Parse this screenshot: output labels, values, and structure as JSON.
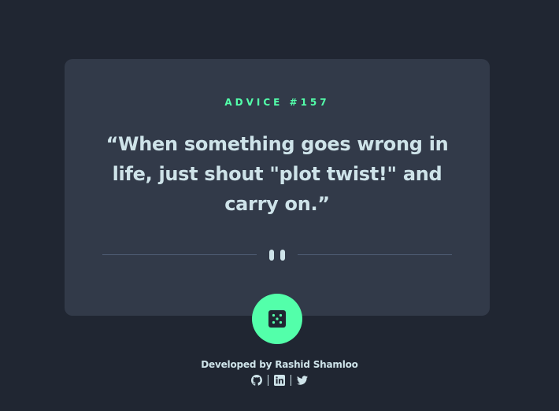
{
  "advice": {
    "label": "ADVICE #157",
    "quote": "“When something goes wrong in life, just shout \"plot twist!\" and carry on.”"
  },
  "dice_button": {
    "icon": "dice-icon"
  },
  "divider": {
    "icon": "pause-icon"
  },
  "footer": {
    "credit": "Developed by Rashid Shamloo",
    "socials": [
      {
        "icon": "github-icon"
      },
      {
        "icon": "linkedin-icon"
      },
      {
        "icon": "twitter-icon"
      }
    ]
  },
  "colors": {
    "background": "#202632",
    "card": "#323a49",
    "accent": "#53ffaa",
    "text": "#cee3e9",
    "divider": "#4f5d74"
  }
}
